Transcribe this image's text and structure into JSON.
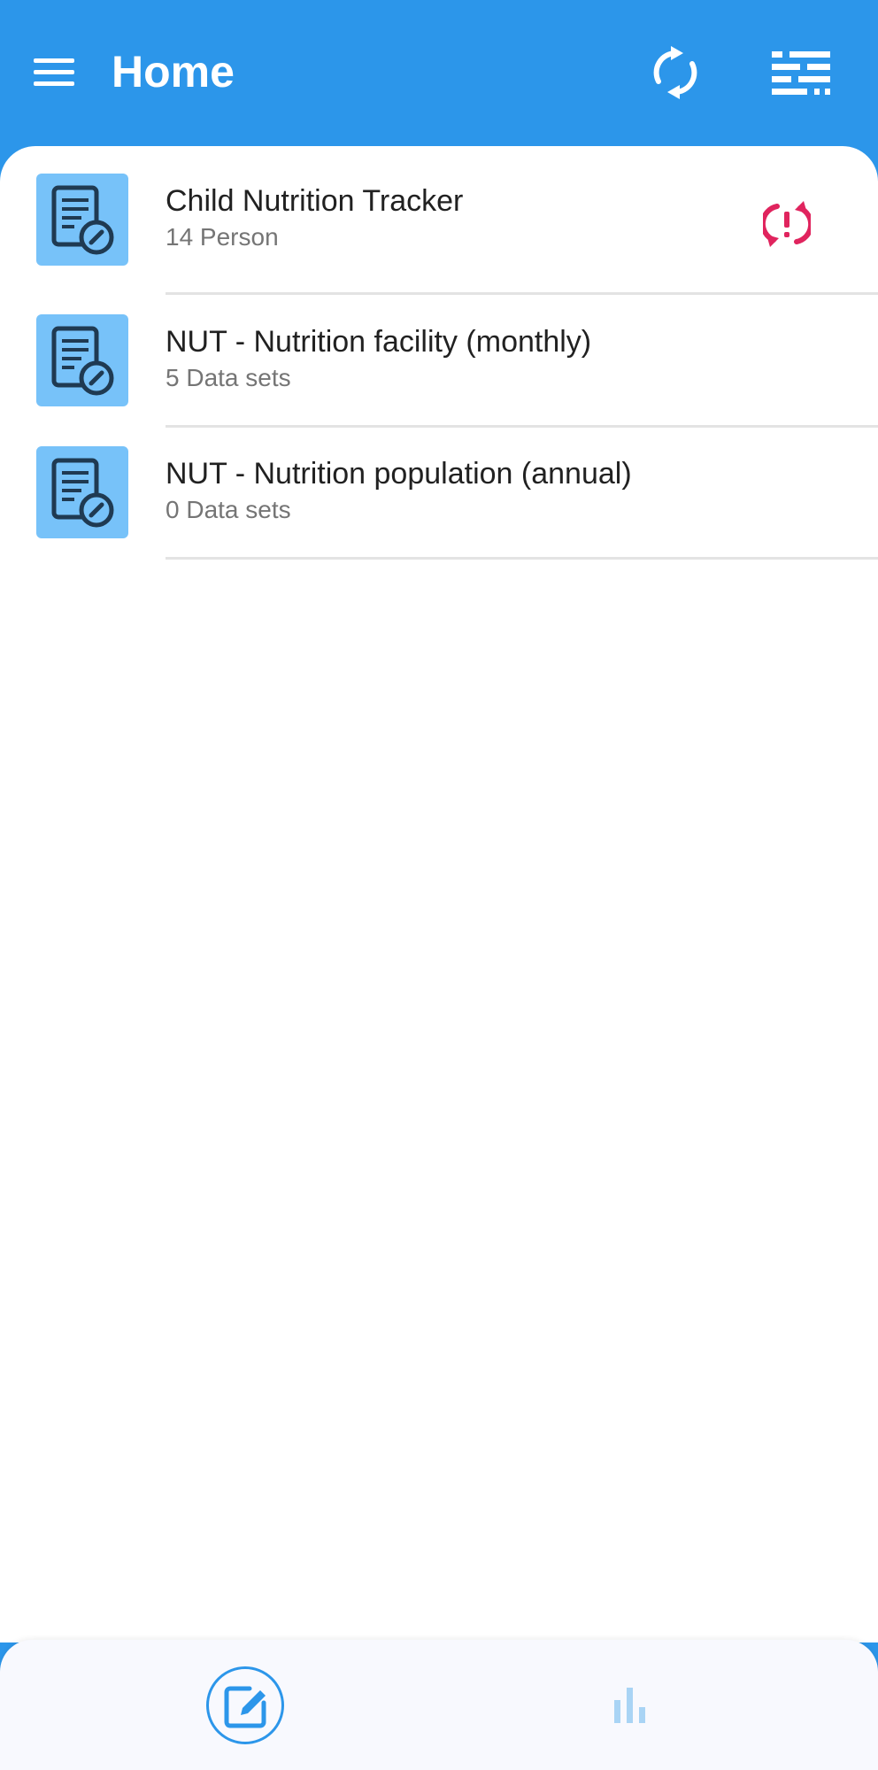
{
  "app_bar": {
    "title": "Home",
    "icons": [
      "menu-icon",
      "sync-icon",
      "filter-icon"
    ]
  },
  "programs": [
    {
      "title": "Child Nutrition Tracker",
      "subtitle": "14 Person",
      "icon": "form-edit-icon",
      "status_icon": "sync-error-icon",
      "status_color": "#e0245e"
    },
    {
      "title": "NUT - Nutrition facility (monthly)",
      "subtitle": "5 Data sets",
      "icon": "form-edit-icon"
    },
    {
      "title": "NUT - Nutrition population (annual)",
      "subtitle": "0 Data sets",
      "icon": "form-edit-icon"
    }
  ],
  "bottom_nav": {
    "items": [
      {
        "icon": "programs-edit-icon",
        "active": true
      },
      {
        "icon": "analytics-bar-chart-icon",
        "active": false
      }
    ]
  },
  "colors": {
    "primary": "#2c96ea",
    "icon_tile": "#77c2f9",
    "icon_dark": "#1f3a52",
    "sync_error": "#e0245e",
    "inactive_nav": "#a9d4f5"
  }
}
